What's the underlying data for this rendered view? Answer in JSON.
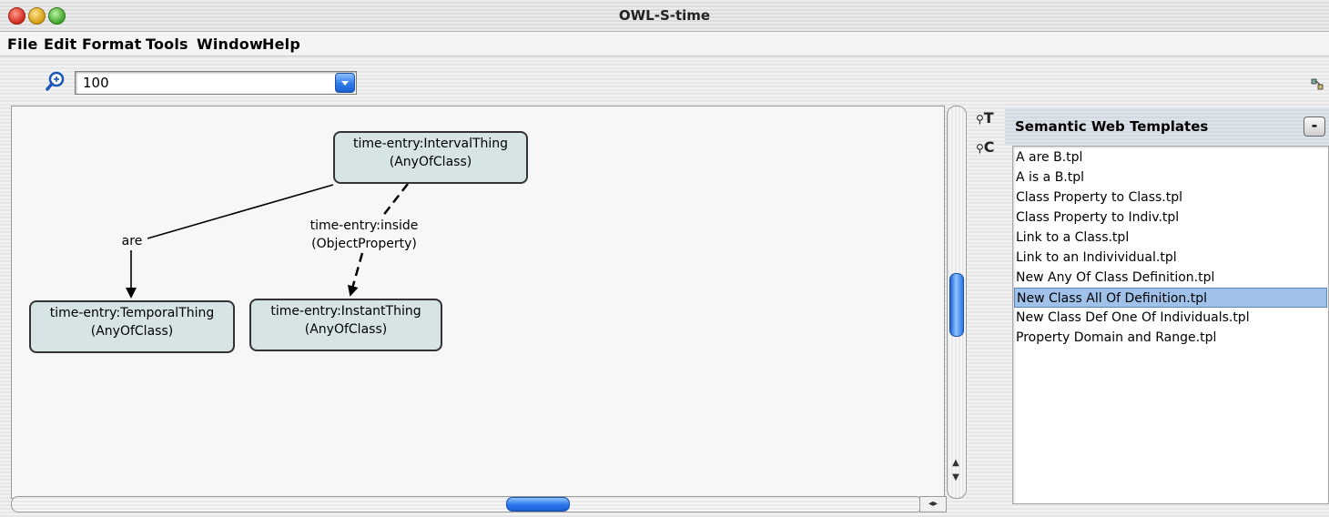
{
  "window": {
    "title": "OWL-S-time"
  },
  "menu": [
    "File",
    "Edit",
    "Format",
    "Tools",
    "Window",
    "Help"
  ],
  "toolbar": {
    "zoom_value": "100"
  },
  "diagram": {
    "nodes": {
      "interval": {
        "line1": "time-entry:IntervalThing",
        "line2": "(AnyOfClass)"
      },
      "temporal": {
        "line1": "time-entry:TemporalThing",
        "line2": "(AnyOfClass)"
      },
      "instant": {
        "line1": "time-entry:InstantThing",
        "line2": "(AnyOfClass)"
      }
    },
    "edges": {
      "are": "are",
      "inside_line1": "time-entry:inside",
      "inside_line2": "(ObjectProperty)"
    }
  },
  "side_tabs": [
    "T",
    "C"
  ],
  "templates_panel": {
    "title": "Semantic Web Templates",
    "collapse_label": "-",
    "items": [
      "A are B.tpl",
      "A is a B.tpl",
      "Class Property to Class.tpl",
      "Class Property to Indiv.tpl",
      "Link to a Class.tpl",
      "Link to an Indivividual.tpl",
      "New Any Of Class Definition.tpl",
      "New Class All Of Definition.tpl",
      "New Class Def One Of Individuals.tpl",
      "Property Domain and Range.tpl"
    ],
    "selected_item": "New Class All Of Definition.tpl"
  }
}
